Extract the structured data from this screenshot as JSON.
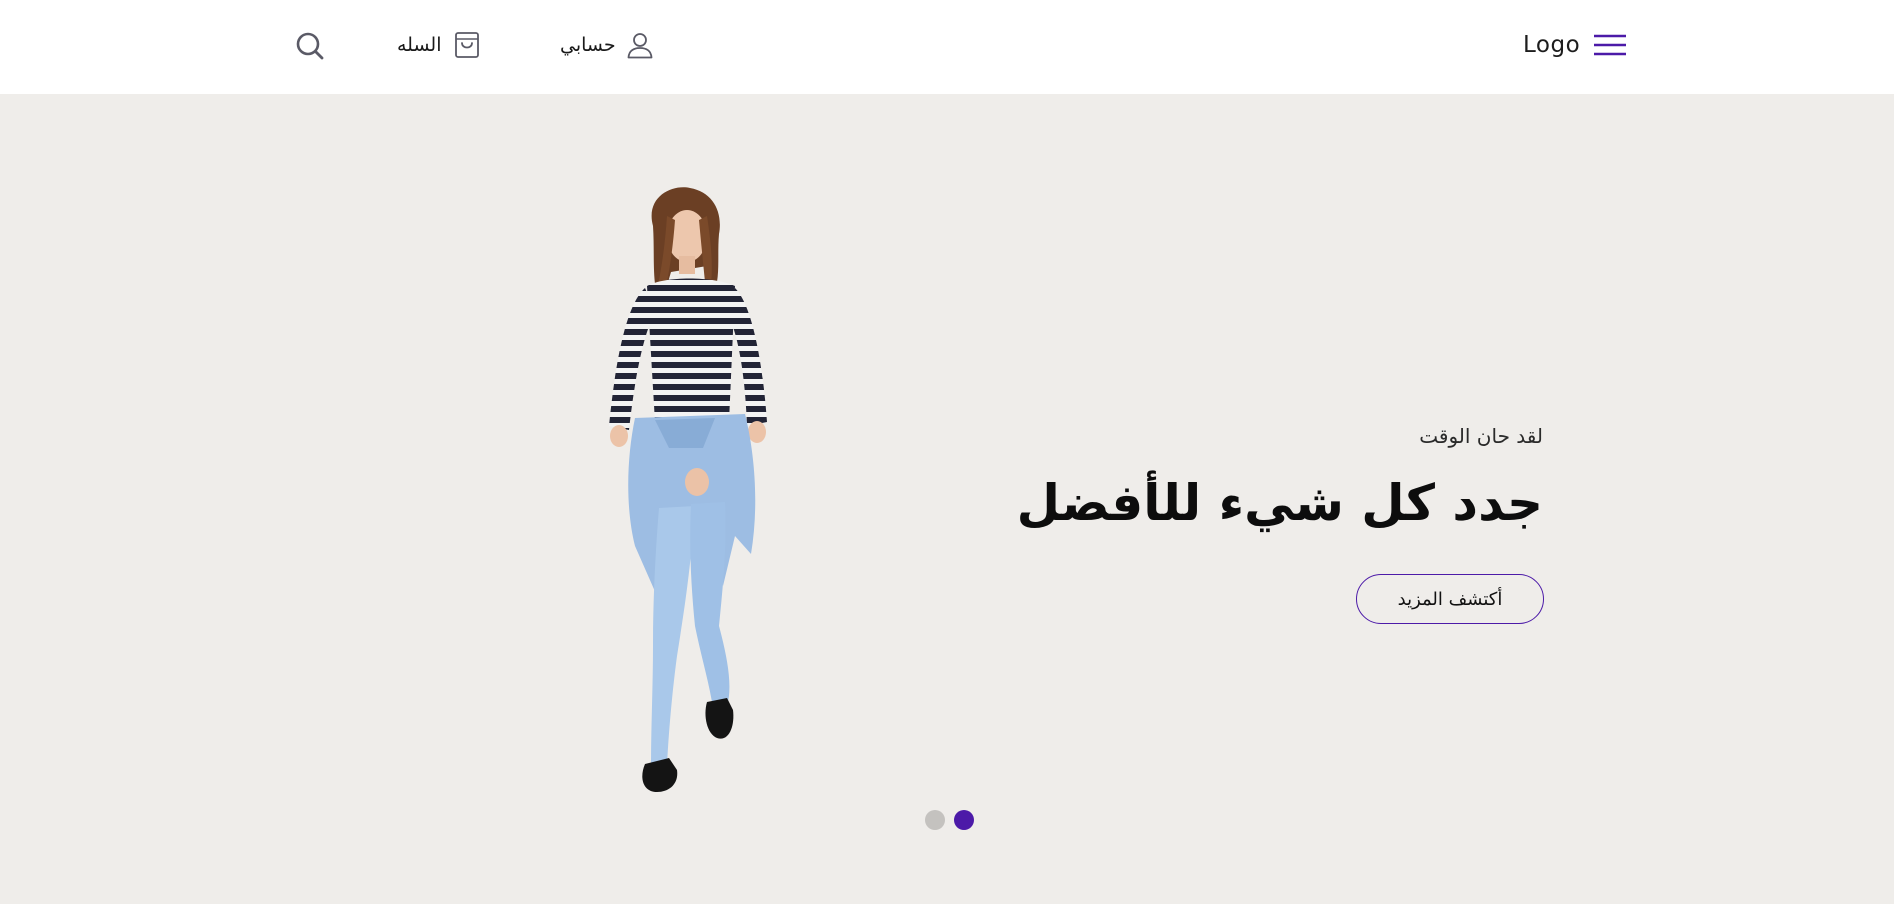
{
  "header": {
    "logo_text": "Logo",
    "menu_icon": "hamburger-icon",
    "account": {
      "label": "حسابي",
      "icon": "user-icon"
    },
    "cart": {
      "label": "السله",
      "icon": "shopping-bag-icon"
    },
    "search": {
      "icon": "search-icon"
    }
  },
  "hero": {
    "eyebrow": "لقد حان الوقت",
    "headline": "جدد كل شيء للأفضل",
    "cta_label": "أكتشف المزيد",
    "image": "fashion-model-image",
    "slides_total": 2,
    "active_slide": 2
  },
  "colors": {
    "accent": "#4c1aa8",
    "dot_inactive": "#c4c2bf",
    "hero_bg": "#efedea",
    "header_bg": "#ffffff"
  }
}
